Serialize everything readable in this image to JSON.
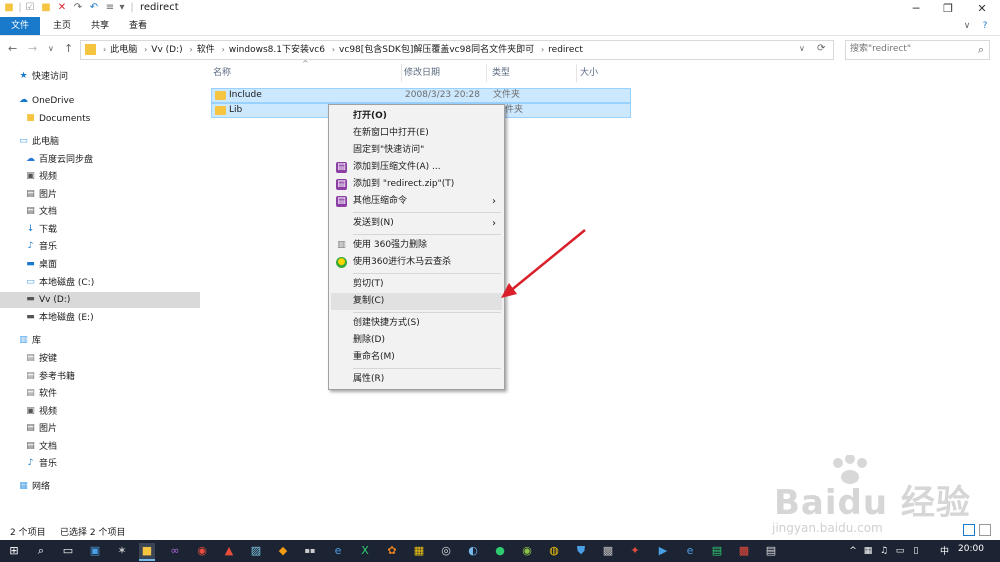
{
  "window": {
    "title": "redirect",
    "minimize": "─",
    "maximize": "❐",
    "close": "✕"
  },
  "quick_access_toolbar": {
    "icons": [
      "folder-icon",
      "properties-icon",
      "new-folder-icon",
      "delete-icon",
      "redo-icon",
      "undo-icon",
      "rename-icon",
      "customize-icon"
    ]
  },
  "ribbon": {
    "tabs": [
      {
        "label": "文件"
      },
      {
        "label": "主页"
      },
      {
        "label": "共享"
      },
      {
        "label": "查看"
      }
    ],
    "expand": "∨",
    "help": "?"
  },
  "address": {
    "back": "←",
    "forward": "→",
    "recent": "∨",
    "up": "↑",
    "crumbs": [
      "此电脑",
      "Vv (D:)",
      "软件",
      "windows8.1下安装vc6",
      "vc98[包含SDK包]解压覆盖vc98同名文件夹即可",
      "redirect"
    ],
    "dropdown": "∨",
    "refresh": "⟳",
    "search_placeholder": "搜索\"redirect\"",
    "search_icon": "⌕"
  },
  "sidebar": {
    "items": [
      {
        "label": "快速访问",
        "icon": "star-icon"
      },
      {
        "label": "OneDrive",
        "icon": "cloud-icon"
      },
      {
        "label": "Documents",
        "icon": "documents-icon"
      },
      {
        "label": "此电脑",
        "icon": "computer-icon"
      },
      {
        "label": "百度云同步盘",
        "icon": "baidu-cloud-icon"
      },
      {
        "label": "视频",
        "icon": "video-icon"
      },
      {
        "label": "图片",
        "icon": "pictures-icon"
      },
      {
        "label": "文档",
        "icon": "document-icon"
      },
      {
        "label": "下载",
        "icon": "download-icon"
      },
      {
        "label": "音乐",
        "icon": "music-icon"
      },
      {
        "label": "桌面",
        "icon": "desktop-icon"
      },
      {
        "label": "本地磁盘 (C:)",
        "icon": "drive-icon"
      },
      {
        "label": "Vv (D:)",
        "icon": "drive-icon"
      },
      {
        "label": "本地磁盘 (E:)",
        "icon": "drive-icon"
      },
      {
        "label": "库",
        "icon": "library-icon"
      },
      {
        "label": "按键",
        "icon": "library-folder-icon"
      },
      {
        "label": "参考书籍",
        "icon": "library-folder-icon"
      },
      {
        "label": "软件",
        "icon": "library-folder-icon"
      },
      {
        "label": "视频",
        "icon": "video-icon"
      },
      {
        "label": "图片",
        "icon": "pictures-icon"
      },
      {
        "label": "文档",
        "icon": "document-icon"
      },
      {
        "label": "音乐",
        "icon": "music-icon"
      },
      {
        "label": "网络",
        "icon": "network-icon"
      }
    ]
  },
  "file_list": {
    "columns": [
      "名称",
      "修改日期",
      "类型",
      "大小"
    ],
    "sort_indicator": "^",
    "rows": [
      {
        "name": "Include",
        "date": "2008/3/23 20:28",
        "type": "文件夹"
      },
      {
        "name": "Lib",
        "type": "件夹"
      }
    ]
  },
  "context_menu": {
    "items": [
      {
        "label": "打开(O)",
        "bold": true
      },
      {
        "label": "在新窗口中打开(E)"
      },
      {
        "label": "固定到\"快速访问\""
      },
      {
        "label": "添加到压缩文件(A) ...",
        "icon": "winrar-icon"
      },
      {
        "label": "添加到 \"redirect.zip\"(T)",
        "icon": "winrar-icon"
      },
      {
        "label": "其他压缩命令",
        "icon": "winrar-icon",
        "submenu": true
      },
      {
        "label": "发送到(N)",
        "submenu": true
      },
      {
        "label": "使用 360强力删除",
        "icon": "shredder-icon"
      },
      {
        "label": "使用360进行木马云查杀",
        "icon": "360-icon"
      },
      {
        "label": "剪切(T)"
      },
      {
        "label": "复制(C)"
      },
      {
        "label": "创建快捷方式(S)"
      },
      {
        "label": "删除(D)"
      },
      {
        "label": "重命名(M)"
      },
      {
        "label": "属性(R)"
      }
    ],
    "submenu_arrow": "›"
  },
  "status_bar": {
    "count": "2 个项目",
    "selected": "已选择 2 个项目"
  },
  "taskbar": {
    "clock": "20:00",
    "ime": "中"
  },
  "watermark": {
    "brand": "Baidu 经验",
    "url": "jingyan.baidu.com"
  },
  "colors": {
    "accent": "#1979ca",
    "selection": "#cce8ff",
    "taskbar": "#1c2433",
    "annotation_arrow": "#d9202a"
  }
}
